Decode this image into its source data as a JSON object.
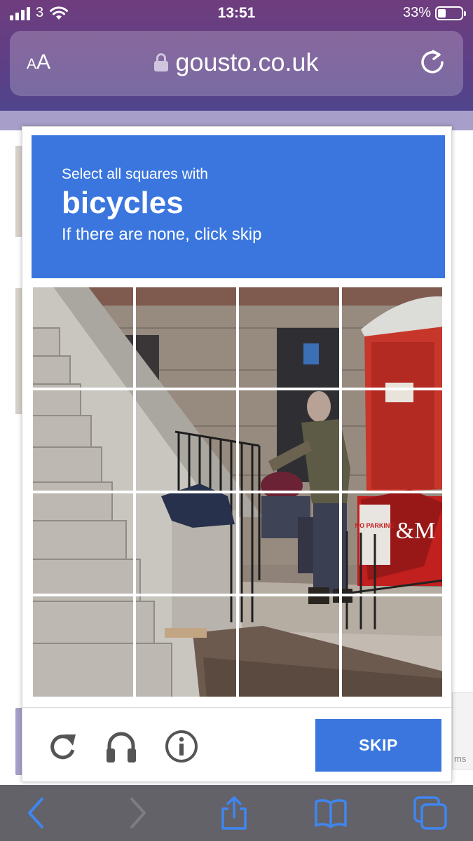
{
  "status_bar": {
    "carrier": "3",
    "time": "13:51",
    "battery_percent": "33%",
    "battery_level": 0.33
  },
  "browser": {
    "text_size_label_small": "A",
    "text_size_label_large": "A",
    "url": "gousto.co.uk"
  },
  "captcha": {
    "header": {
      "line1": "Select all squares with",
      "keyword": "bicycles",
      "line3": "If there are none, click skip"
    },
    "grid": {
      "rows": 4,
      "cols": 4,
      "scene_sign_text": "NO PARKING",
      "scene_company_initials": "&M"
    },
    "footer": {
      "skip_label": "SKIP",
      "icons": [
        "reload-icon",
        "audio-challenge-icon",
        "info-icon"
      ]
    }
  },
  "side_widget_text": "ms",
  "toolbar": {
    "icons": [
      "back-icon",
      "forward-icon",
      "share-icon",
      "bookmarks-icon",
      "tabs-icon"
    ]
  },
  "colors": {
    "accent_blue": "#3a76dd",
    "safari_purple": "#5d3f86",
    "toolbar_icon_blue": "#3f86f2"
  }
}
